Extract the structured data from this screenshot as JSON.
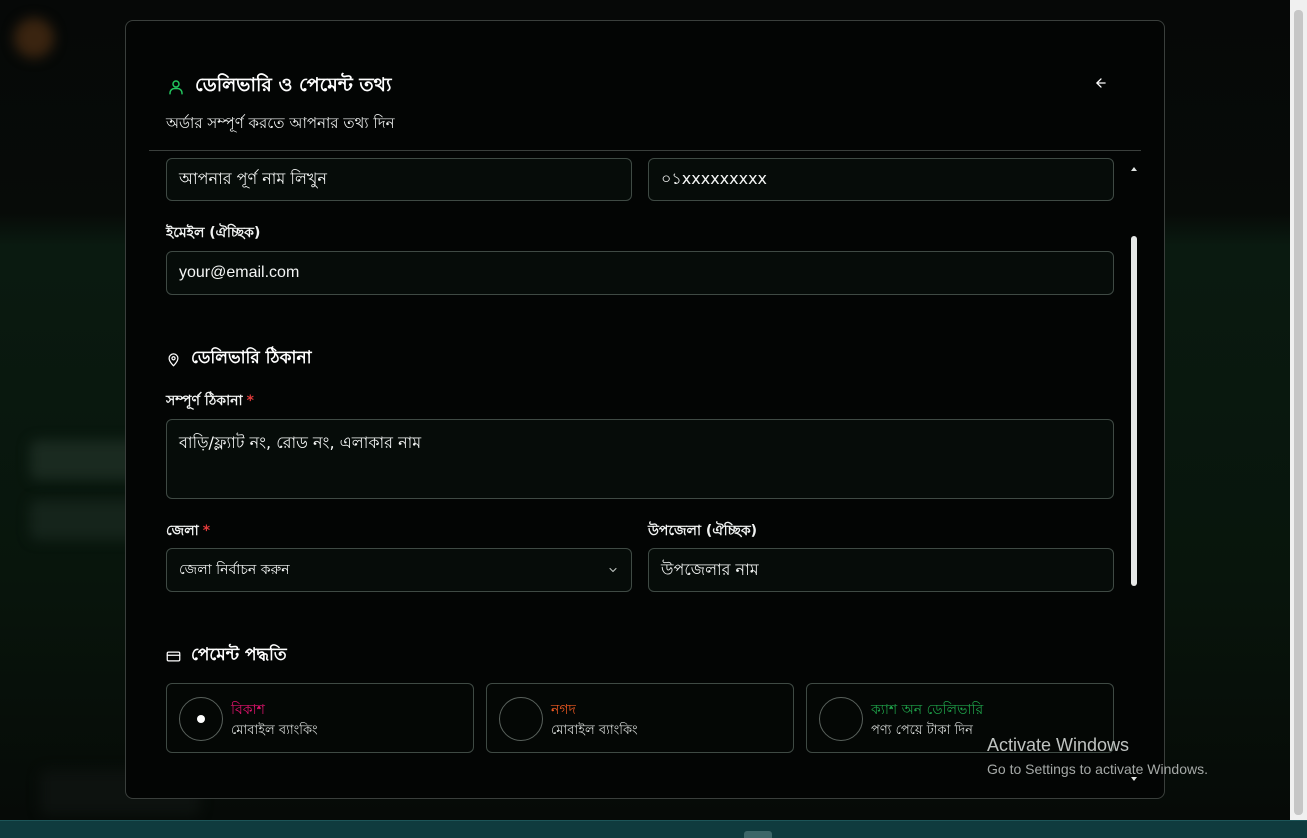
{
  "modal": {
    "title": "ডেলিভারি ও পেমেন্ট তথ্য",
    "subtitle": "অর্ডার সম্পূর্ণ করতে আপনার তথ্য দিন"
  },
  "customer": {
    "name_placeholder": "আপনার পূর্ণ নাম লিখুন",
    "phone_placeholder": "০১xxxxxxxxx",
    "email_label": "ইমেইল (ঐচ্ছিক)",
    "email_placeholder": "your@email.com"
  },
  "address": {
    "section_title": "ডেলিভারি ঠিকানা",
    "full_address_label": "সম্পূর্ণ ঠিকানা",
    "full_address_placeholder": "বাড়ি/ফ্ল্যাট নং, রোড নং, এলাকার নাম",
    "district_label": "জেলা",
    "district_selected": "জেলা নির্বাচন করুন",
    "upazila_label": "উপজেলা (ঐচ্ছিক)",
    "upazila_placeholder": "উপজেলার নাম",
    "required_mark": "*"
  },
  "payment": {
    "section_title": "পেমেন্ট পদ্ধতি",
    "options": [
      {
        "name": "বিকাশ",
        "desc": "মোবাইল ব্যাংকিং",
        "color": "#e2136e",
        "selected": true
      },
      {
        "name": "নগদ",
        "desc": "মোবাইল ব্যাংকিং",
        "color": "#f15a22",
        "selected": false
      },
      {
        "name": "ক্যাশ অন ডেলিভারি",
        "desc": "পণ্য পেয়ে টাকা দিন",
        "color": "#1fa24a",
        "selected": false
      }
    ]
  },
  "os_watermark": {
    "line1": "Activate Windows",
    "line2": "Go to Settings to activate Windows."
  },
  "colors": {
    "accent_green": "#22c55e",
    "required_red": "#e23b3b"
  }
}
